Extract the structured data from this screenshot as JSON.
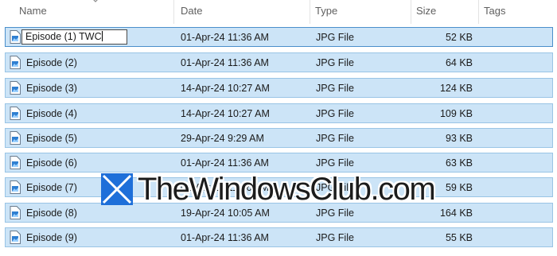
{
  "columns": [
    {
      "label": "Name"
    },
    {
      "label": "Date"
    },
    {
      "label": "Type"
    },
    {
      "label": "Size"
    },
    {
      "label": "Tags"
    }
  ],
  "rename": {
    "value": "Episode (1) TWC"
  },
  "files": [
    {
      "name": "Episode (1) TWC",
      "date": "01-Apr-24 11:36 AM",
      "type": "JPG File",
      "size": "52 KB",
      "renaming": true
    },
    {
      "name": "Episode (2)",
      "date": "01-Apr-24 11:36 AM",
      "type": "JPG File",
      "size": "64 KB"
    },
    {
      "name": "Episode (3)",
      "date": "14-Apr-24 10:27 AM",
      "type": "JPG File",
      "size": "124 KB"
    },
    {
      "name": "Episode (4)",
      "date": "14-Apr-24 10:27 AM",
      "type": "JPG File",
      "size": "109 KB"
    },
    {
      "name": "Episode (5)",
      "date": "29-Apr-24 9:29 AM",
      "type": "JPG File",
      "size": "93 KB"
    },
    {
      "name": "Episode (6)",
      "date": "01-Apr-24 11:36 AM",
      "type": "JPG File",
      "size": "63 KB"
    },
    {
      "name": "Episode (7)",
      "date": "01-Apr-24 11:36 AM",
      "type": "JPG File",
      "size": "59 KB"
    },
    {
      "name": "Episode (8)",
      "date": "19-Apr-24 10:05 AM",
      "type": "JPG File",
      "size": "164 KB"
    },
    {
      "name": "Episode (9)",
      "date": "01-Apr-24 11:36 AM",
      "type": "JPG File",
      "size": "55 KB"
    }
  ],
  "watermark": {
    "text": "TheWindowsClub.com"
  },
  "icons": {
    "file": "jpg-file-icon",
    "sort": "sort-caret-icon",
    "logo": "windowsclub-logo-icon"
  },
  "colors": {
    "selection": "#cce4f7",
    "selection_border": "#99c4e5",
    "header_text": "#5f5f5f"
  }
}
